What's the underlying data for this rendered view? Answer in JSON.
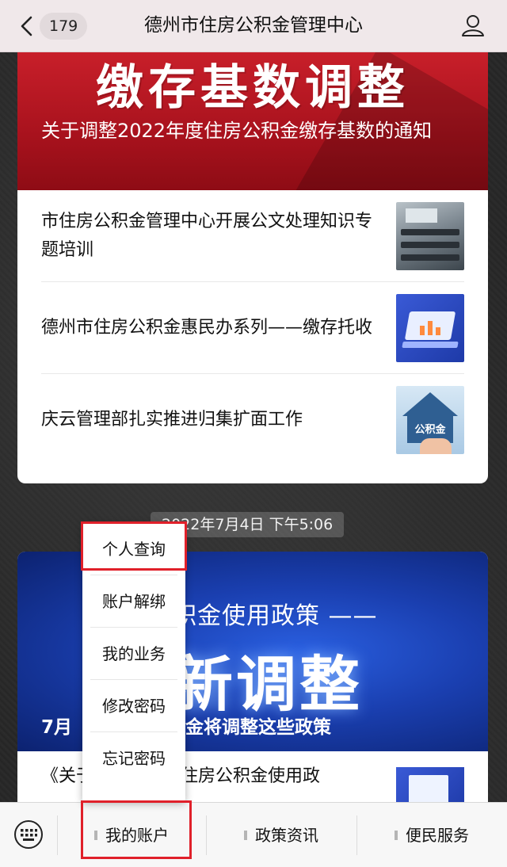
{
  "nav": {
    "unread_count": "179",
    "title": "德州市住房公积金管理中心"
  },
  "card1": {
    "banner_big": "缴存基数调整",
    "banner_title": "关于调整2022年度住房公积金缴存基数的通知",
    "articles": [
      {
        "title": "市住房公积金管理中心开展公文处理知识专题培训",
        "thumb": "meeting-photo"
      },
      {
        "title": "德州市住房公积金惠民办系列——缴存托收",
        "thumb": "laptop-illustration"
      },
      {
        "title": "庆云管理部扎实推进归集扩面工作",
        "thumb": "house-illustration",
        "thumb_label": "公积金"
      }
    ]
  },
  "timestamp": "2022年7月4日 下午5:06",
  "card2": {
    "banner_line": "积金使用政策 ——",
    "banner_big": "新调整",
    "banner_sub_left": "7月",
    "banner_sub_right": "金将调整这些政策",
    "article_title": "《关于进一步调整住房公积金使用政"
  },
  "popup_menu": {
    "items": [
      "个人查询",
      "账户解绑",
      "我的业务",
      "修改密码",
      "忘记密码"
    ],
    "highlighted": "个人查询"
  },
  "bottom_menu": {
    "tabs": [
      "我的账户",
      "政策资讯",
      "便民服务"
    ],
    "highlighted": "我的账户"
  },
  "colors": {
    "highlight": "#e0202a",
    "navbar_bg": "#f0e8ea",
    "banner_red": "#c81f2a",
    "banner_blue": "#1a3fb0"
  }
}
